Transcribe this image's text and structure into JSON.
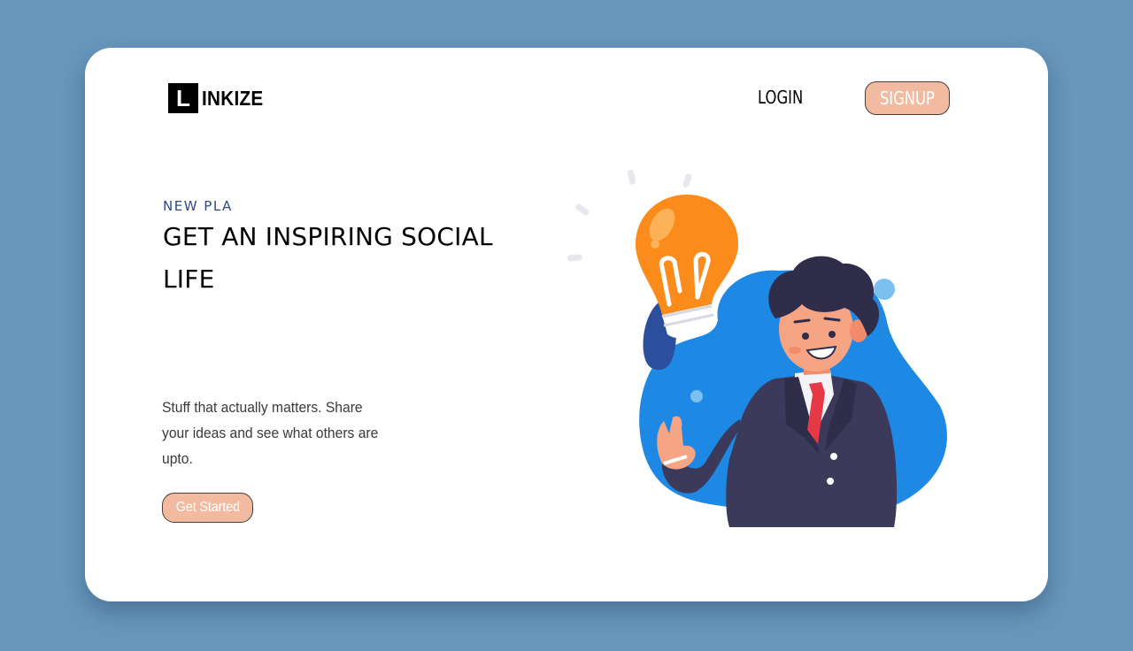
{
  "brand": {
    "mark": "L",
    "name": "INKIZE"
  },
  "nav": {
    "login_label": "LOGIN",
    "signup_label": "SIGNUP"
  },
  "hero": {
    "eyebrow": "NEW PLA",
    "headline": "GET AN INSPIRING SOCIAL LIFE",
    "description": "Stuff that actually matters. Share your ideas and see what others are upto.",
    "cta_label": "Get Started"
  },
  "illustration": {
    "icon": "businessman-lightbulb-illustration"
  },
  "colors": {
    "background": "#6797bc",
    "card": "#ffffff",
    "accent_button": "#f2bba1",
    "blob_blue": "#1e88e5",
    "bulb_orange": "#fb8c1c",
    "suit": "#3c3a5b"
  }
}
